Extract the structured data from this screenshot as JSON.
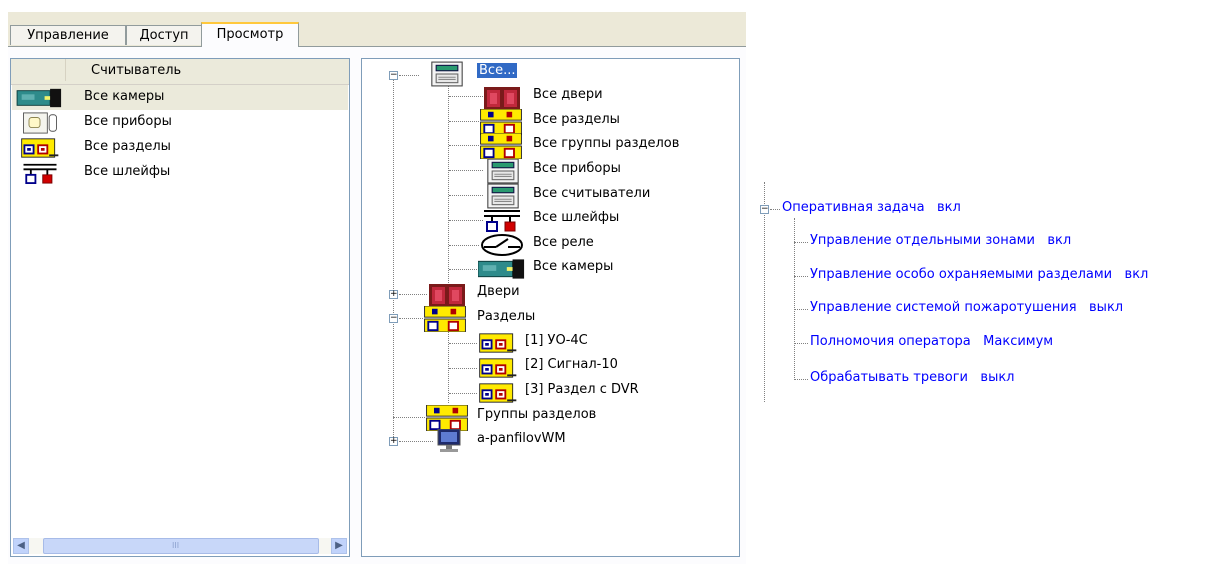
{
  "tabs": [
    {
      "label": "Управление"
    },
    {
      "label": "Доступ"
    },
    {
      "label": "Просмотр"
    }
  ],
  "left_list": {
    "header": "Считыватель",
    "items": [
      {
        "label": "Все камеры",
        "icon": "camera-icon"
      },
      {
        "label": "Все приборы",
        "icon": "device-panel-icon"
      },
      {
        "label": "Все разделы",
        "icon": "partition-icon"
      },
      {
        "label": "Все шлейфы",
        "icon": "loops-icon"
      }
    ],
    "scroll_thumb_grip": "III"
  },
  "tree": {
    "root": "Все...",
    "all_children": [
      {
        "label": "Все двери",
        "icon": "door-icon"
      },
      {
        "label": "Все разделы",
        "icon": "partition-group-icon"
      },
      {
        "label": "Все группы разделов",
        "icon": "partition-group-icon"
      },
      {
        "label": "Все приборы",
        "icon": "controller-icon"
      },
      {
        "label": "Все считыватели",
        "icon": "controller-icon"
      },
      {
        "label": "Все шлейфы",
        "icon": "loops-icon"
      },
      {
        "label": "Все реле",
        "icon": "relay-icon"
      },
      {
        "label": "Все камеры",
        "icon": "camera-icon"
      }
    ],
    "doors": "Двери",
    "partitions": "Разделы",
    "partition_items": [
      {
        "label": "[1] УО-4С"
      },
      {
        "label": "[2] Сигнал-10"
      },
      {
        "label": "[3] Раздел с DVR"
      }
    ],
    "partition_groups": "Группы разделов",
    "workstation": "a-panfilovWM"
  },
  "right_tree": {
    "root": {
      "label": "Оперативная задача",
      "value": "вкл"
    },
    "items": [
      {
        "label": "Управление отдельными зонами",
        "value": "вкл"
      },
      {
        "label": "Управление особо охраняемыми разделами",
        "value": "вкл"
      },
      {
        "label": "Управление системой пожаротушения",
        "value": "выкл"
      },
      {
        "label": "Полномочия оператора",
        "value": "Максимум"
      },
      {
        "label": "Обрабатывать тревоги",
        "value": "выкл"
      }
    ]
  },
  "colors": {
    "link": "#0000ff",
    "selection": "#316ac5",
    "tab_accent": "#ffc83c"
  }
}
